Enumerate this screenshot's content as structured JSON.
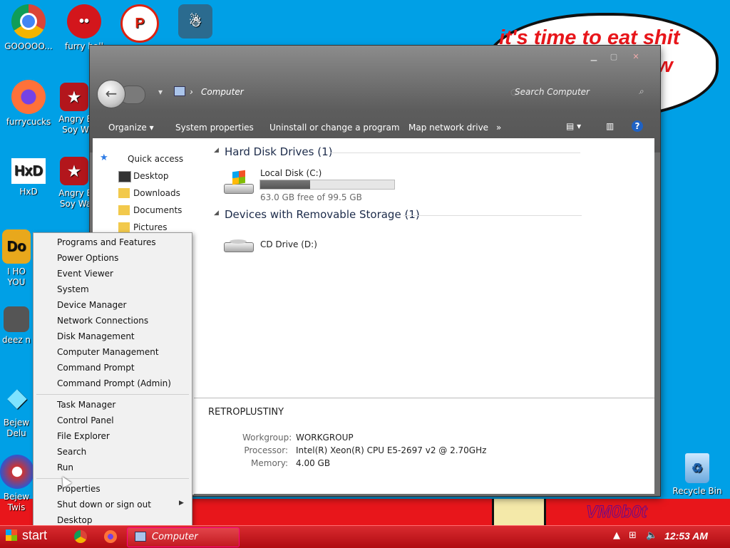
{
  "wallpaper": {
    "bubble_line1": "it's time to eat shit",
    "bubble_line2": "ew",
    "signature": "VM0b0t",
    "colors": {
      "sky": "#00a0e6",
      "red": "#e8161b"
    }
  },
  "desktop_icons": [
    {
      "label": "GOOOOO...",
      "icon": "chrome-icon"
    },
    {
      "label": "furry ball",
      "icon": "ball-icon"
    },
    {
      "label": "furrycucks",
      "icon": "firefox-icon"
    },
    {
      "label": "Angry B Soy W",
      "icon": "angry-birds-icon"
    },
    {
      "label": "HxD",
      "icon": "hxd-icon"
    },
    {
      "label": "Angry B Soy Wa",
      "icon": "angry-birds-icon"
    },
    {
      "label": "I HO YOU",
      "icon": "app-icon"
    },
    {
      "label": "deez n",
      "icon": "folder-icon"
    },
    {
      "label": "Bejew Delu",
      "icon": "bejeweled-icon"
    },
    {
      "label": "Bejew Twis",
      "icon": "bejeweled-twist-icon"
    },
    {
      "label": "Recycle Bin",
      "icon": "recycle-bin-icon"
    }
  ],
  "explorer": {
    "breadcrumb_root": "Computer",
    "search_placeholder": "Search Computer",
    "toolbar": [
      "Organize",
      "System properties",
      "Uninstall or change a program",
      "Map network drive",
      "»"
    ],
    "nav": {
      "quick_access": "Quick access",
      "items": [
        "Desktop",
        "Downloads",
        "Documents",
        "Pictures"
      ]
    },
    "groups": {
      "hdd": "Hard Disk Drives (1)",
      "removable": "Devices with Removable Storage (1)"
    },
    "drives": {
      "c_name": "Local Disk (C:)",
      "c_free": "63.0 GB free of 99.5 GB",
      "c_used_fraction": 0.37,
      "d_name": "CD Drive (D:)"
    },
    "details": {
      "computer_name": "RETROPLUSTINY",
      "workgroup_label": "Workgroup:",
      "workgroup_value": "WORKGROUP",
      "processor_label": "Processor:",
      "processor_value": "Intel(R) Xeon(R) CPU E5-2697 v2 @ 2.70GHz",
      "memory_label": "Memory:",
      "memory_value": "4.00 GB"
    }
  },
  "context_menu": {
    "group1": [
      "Programs and Features",
      "Power Options",
      "Event Viewer",
      "System",
      "Device Manager",
      "Network Connections",
      "Disk Management",
      "Computer Management",
      "Command Prompt",
      "Command Prompt (Admin)"
    ],
    "group2": [
      "Task Manager",
      "Control Panel",
      "File Explorer",
      "Search",
      "Run"
    ],
    "group3": [
      "Properties",
      "Shut down or sign out",
      "Desktop"
    ]
  },
  "taskbar": {
    "start_label": "start",
    "window_label": "Computer",
    "clock": "12:53 AM"
  }
}
